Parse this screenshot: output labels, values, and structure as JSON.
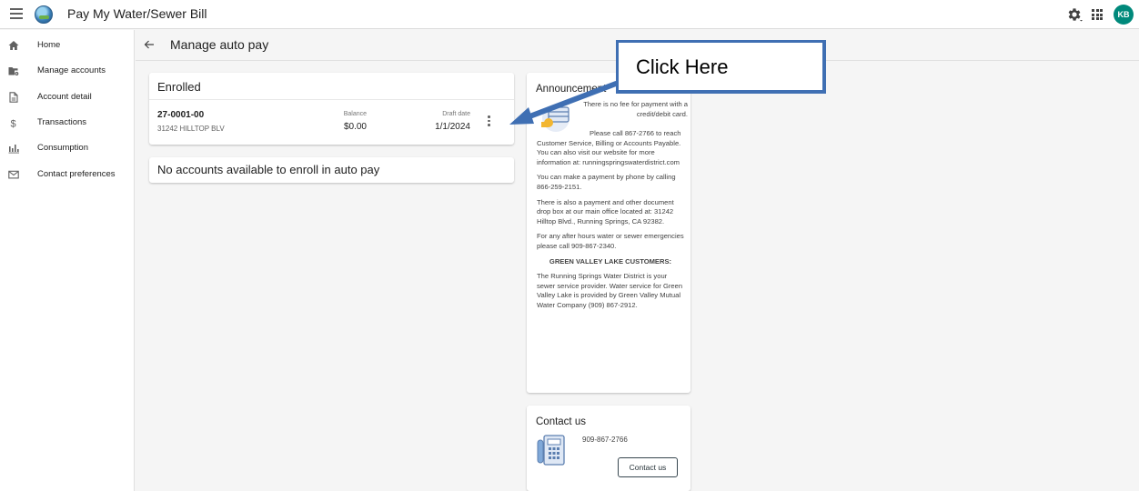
{
  "app": {
    "title": "Pay My Water/Sewer Bill",
    "avatar_initials": "KB",
    "accent_color": "#00897b"
  },
  "icons": {
    "menu": "hamburger-icon",
    "settings": "gear-icon",
    "apps": "grid-icon",
    "back": "arrow-left-icon"
  },
  "sidebar": {
    "items": [
      {
        "label": "Home",
        "icon": "home-icon"
      },
      {
        "label": "Manage accounts",
        "icon": "folder-settings-icon"
      },
      {
        "label": "Account detail",
        "icon": "document-icon"
      },
      {
        "label": "Transactions",
        "icon": "dollar-icon"
      },
      {
        "label": "Consumption",
        "icon": "bar-chart-icon"
      },
      {
        "label": "Contact preferences",
        "icon": "envelope-icon"
      }
    ]
  },
  "page": {
    "title": "Manage auto pay"
  },
  "enrolled": {
    "title": "Enrolled",
    "account": {
      "number": "27-0001-00",
      "address": "31242 HILLTOP BLV",
      "balance_label": "Balance",
      "balance": "$0.00",
      "draft_label": "Draft date",
      "draft_date": "1/1/2024"
    }
  },
  "not_available": {
    "title": "No accounts available to enroll in auto pay"
  },
  "announcements": {
    "title": "Announcement",
    "first": "There is no fee for payment with a credit/debit card.",
    "paragraphs": [
      "Please call 867-2766 to reach Customer Service, Billing or Accounts Payable. You can also visit our website for more information at: runningspringswaterdistrict.com",
      "You can make a payment by phone by calling 866-259-2151.",
      "There is also a payment and other document drop box at our main office located at: 31242 Hilltop Blvd., Running Springs, CA 92382.",
      "For any after hours water or sewer emergencies please call 909-867-2340.",
      "GREEN VALLEY LAKE CUSTOMERS:",
      "The Running Springs Water District is your sewer service provider. Water service for Green Valley Lake is provided by Green Valley Mutual Water Company (909) 867-2912."
    ]
  },
  "contact": {
    "title": "Contact us",
    "phone": "909-867-2766",
    "button_label": "Contact us"
  },
  "callout": {
    "text": "Click Here",
    "color": "#3f6fb3"
  }
}
